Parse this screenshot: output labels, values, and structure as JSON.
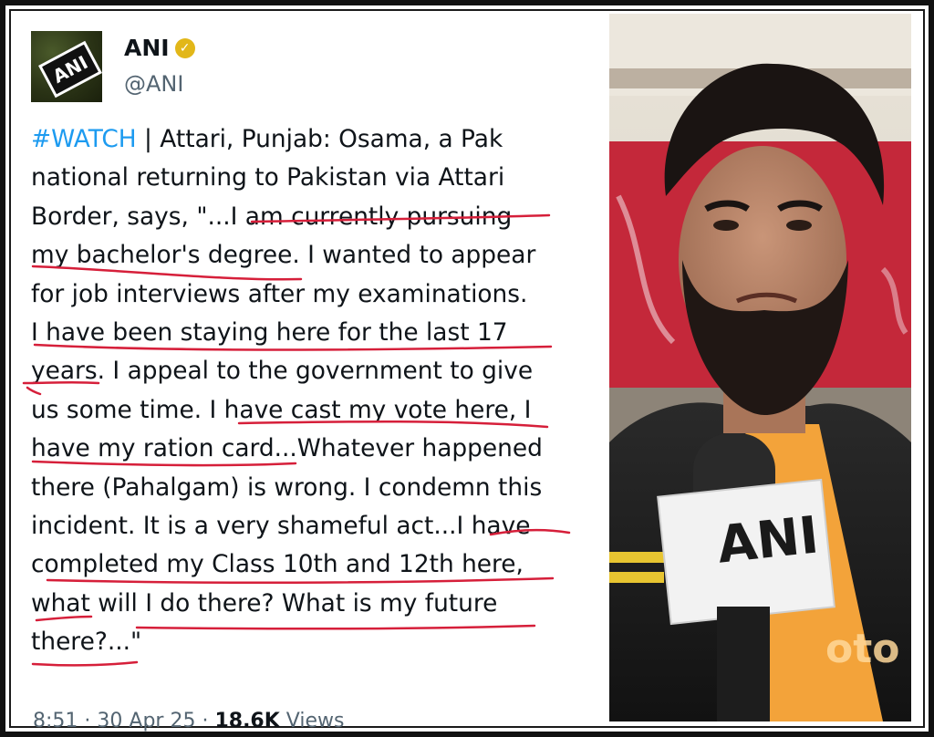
{
  "account": {
    "display_name": "ANI",
    "handle": "@ANI",
    "avatar_label": "ANI",
    "verified_badge": "✓"
  },
  "tweet": {
    "hashtag": "#WATCH",
    "text": " | Attari, Punjab: Osama, a Pak\nnational returning to Pakistan via Attari\nBorder, says, \"...I am currently pursuing\nmy bachelor's degree. I wanted to appear\nfor job interviews after my examinations.\nI have been staying here for the last 17\nyears. I appeal to the government to give\nus some time. I have cast my vote here, I\nhave my ration card...Whatever happened\nthere (Pahalgam) is wrong. I condemn this\nincident. It is a very shameful act...I have\ncompleted my Class 10th and 12th here,\nwhat will I do there? What is my future\nthere?...\""
  },
  "meta": {
    "time": "8:51",
    "date": "30 Apr 25",
    "views_count": "18.6K",
    "views_label": "Views",
    "separator": "·"
  },
  "photo": {
    "mic_label": "ANI",
    "shirt_text": "oto"
  },
  "colors": {
    "hashtag": "#1d9bf0",
    "underline": "#d61f3a",
    "verified": "#e2b719",
    "muted_text": "#536471"
  }
}
